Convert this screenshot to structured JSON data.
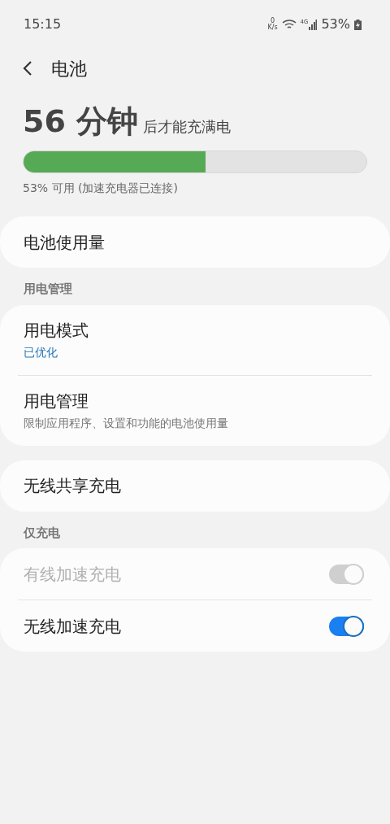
{
  "status_bar": {
    "time": "15:15",
    "net_speed": {
      "value": "0",
      "unit": "K/s"
    },
    "network": "4G",
    "battery": "53%"
  },
  "header": {
    "title": "电池"
  },
  "charge": {
    "time": "56 分钟",
    "suffix": "后才能充满电",
    "level": 0.53,
    "caption": "53% 可用 (加速充电器已连接)"
  },
  "groups": [
    {
      "items": [
        {
          "kind": "link",
          "title": "电池使用量"
        }
      ]
    },
    {
      "heading": "用电管理",
      "items": [
        {
          "kind": "link",
          "title": "用电模式",
          "subtitle": "已优化",
          "accent": true
        },
        {
          "kind": "link",
          "title": "用电管理",
          "subtitle": "限制应用程序、设置和功能的电池使用量",
          "accent": false
        }
      ]
    },
    {
      "items": [
        {
          "kind": "link",
          "title": "无线共享充电"
        }
      ]
    },
    {
      "heading": "仅充电",
      "items": [
        {
          "kind": "switch",
          "title": "有线加速充电",
          "on": true,
          "disabled": true
        },
        {
          "kind": "switch",
          "title": "无线加速充电",
          "on": true,
          "disabled": false
        }
      ]
    }
  ]
}
